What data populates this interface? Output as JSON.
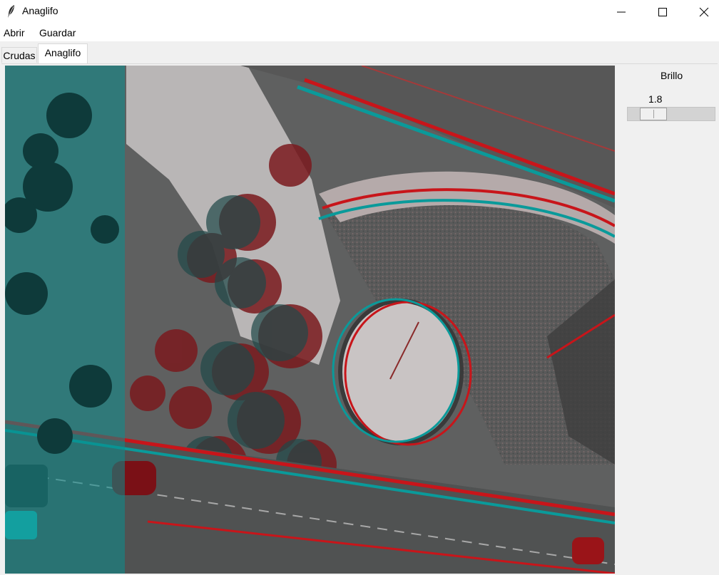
{
  "window": {
    "title": "Anaglifo",
    "icon": "feather-icon",
    "controls": [
      "minimize-icon",
      "maximize-icon",
      "close-icon"
    ]
  },
  "menu": {
    "items": [
      {
        "label": "Abrir"
      },
      {
        "label": "Guardar"
      }
    ]
  },
  "tabs": [
    {
      "label": "Crudas",
      "selected": false
    },
    {
      "label": "Anaglifo",
      "selected": true
    }
  ],
  "main": {
    "image": "anaglyph-aerial-photo"
  },
  "controls": {
    "brillo_label": "Brillo",
    "brillo_value": "1.8",
    "brillo_fraction": 0.15
  },
  "colors": {
    "cyan_channel": "#0a9a9a",
    "red_channel": "#c8151a"
  }
}
